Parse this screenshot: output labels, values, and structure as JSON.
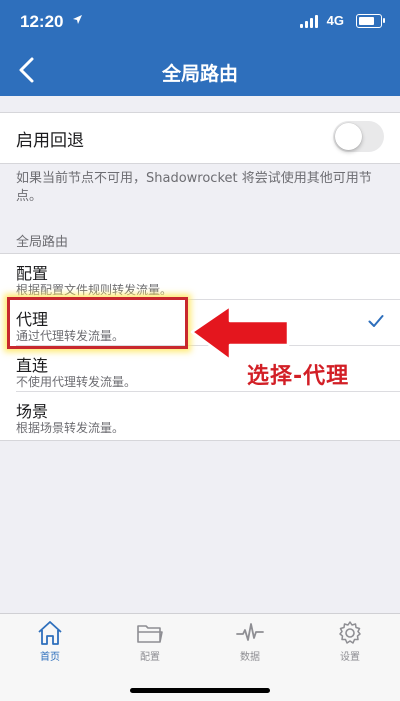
{
  "status": {
    "time": "12:20",
    "network": "4G",
    "battery_level": 0.85
  },
  "nav": {
    "title": "全局路由"
  },
  "fallback": {
    "label": "启用回退",
    "enabled": false,
    "note": "如果当前节点不可用，Shadowrocket 将尝试使用其他可用节点。"
  },
  "section": {
    "header": "全局路由"
  },
  "options": [
    {
      "title": "配置",
      "subtitle": "根据配置文件规则转发流量。",
      "selected": false
    },
    {
      "title": "代理",
      "subtitle": "通过代理转发流量。",
      "selected": true
    },
    {
      "title": "直连",
      "subtitle": "不使用代理转发流量。",
      "selected": false
    },
    {
      "title": "场景",
      "subtitle": "根据场景转发流量。",
      "selected": false
    }
  ],
  "annotation": {
    "text": "选择-代理",
    "color": "#d21f26"
  },
  "tabs": [
    {
      "label": "首页",
      "icon": "home-icon",
      "active": true
    },
    {
      "label": "配置",
      "icon": "folder-icon",
      "active": false
    },
    {
      "label": "数据",
      "icon": "waveform-icon",
      "active": false
    },
    {
      "label": "设置",
      "icon": "gear-icon",
      "active": false
    }
  ],
  "colors": {
    "accent": "#2e6fbc",
    "background": "#efeff4",
    "annotation_red": "#d21f26"
  }
}
